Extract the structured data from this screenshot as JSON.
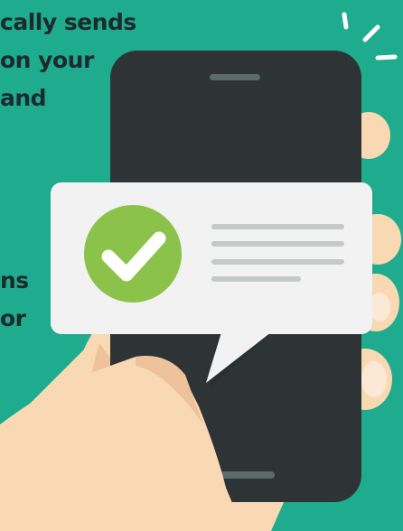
{
  "text_fragments": {
    "line1": "cally sends",
    "line2": "on your",
    "line3": "and",
    "line4": "ns",
    "line5": "or"
  },
  "colors": {
    "background": "#1fab8d",
    "phone_body": "#2e3436",
    "phone_screen": "#3a4043",
    "speaker": "#5b6b6a",
    "home_bar": "#5b6b6a",
    "hand_skin": "#f9d8b4",
    "hand_shade": "#eec29b",
    "nail": "#fbe9d6",
    "bubble": "#f1f2f1",
    "check_circle": "#8bc34a",
    "check_mark": "#ffffff",
    "bubble_lines": "#c6c9c9",
    "sparkle": "#ffffff"
  },
  "icons": {
    "checkmark": "check-circle-icon",
    "sparkle": "sparkle-icon"
  }
}
